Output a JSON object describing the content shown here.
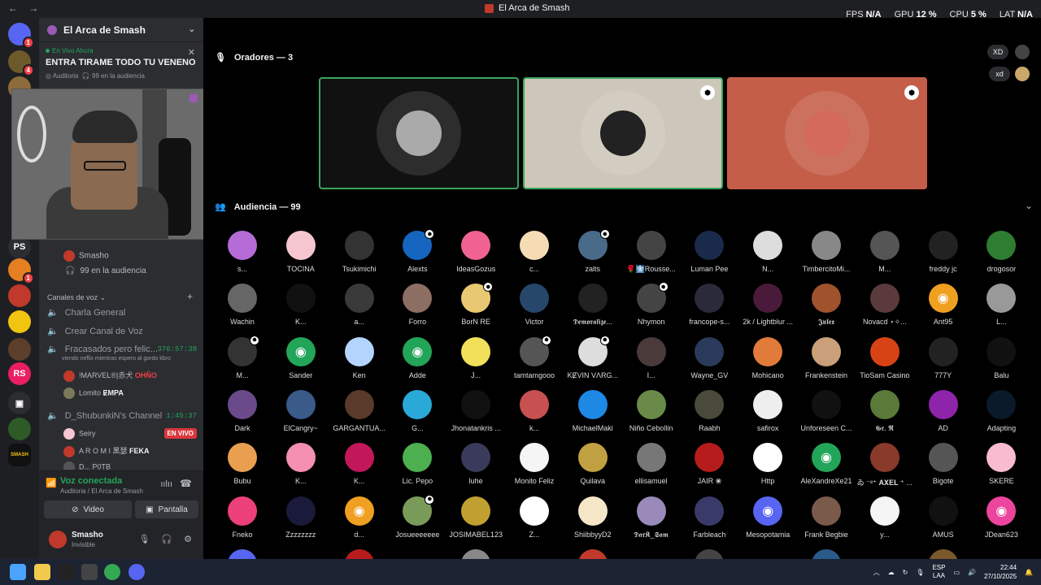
{
  "window": {
    "title": "El Arca de Smash",
    "back": "←",
    "forward": "→"
  },
  "perf": {
    "fps_label": "FPS",
    "fps": "N/A",
    "gpu_label": "GPU",
    "gpu": "12 %",
    "cpu_label": "CPU",
    "cpu": "5 %",
    "lat_label": "LAT",
    "lat": "N/A"
  },
  "servers": [
    {
      "label": "",
      "color": "#5865f2",
      "badge": "1"
    },
    {
      "label": "",
      "color": "#6d5a2a",
      "badge": "4"
    },
    {
      "label": "",
      "color": "#8e6b3b",
      "badge": ""
    },
    {
      "label": "PS",
      "color": "#2b2d31",
      "badge": ""
    },
    {
      "label": "",
      "color": "#e67e22",
      "badge": "1"
    },
    {
      "label": "",
      "color": "#c0392b",
      "badge": ""
    },
    {
      "label": "",
      "color": "#f1c40f",
      "badge": ""
    },
    {
      "label": "",
      "color": "#5b3f2a",
      "badge": ""
    },
    {
      "label": "RS",
      "color": "#e91e63",
      "badge": ""
    },
    {
      "label": "▣",
      "color": "#2b2d31",
      "badge": ""
    },
    {
      "label": "",
      "color": "#2d5a27",
      "badge": ""
    },
    {
      "label": "SMASH",
      "color": "#111111",
      "badge": ""
    }
  ],
  "sidebar": {
    "server_name": "El Arca de Smash",
    "stage": {
      "live_label": "En Vivo Ahora",
      "title": "ENTRA TIRAME TODO TU VENENO",
      "channel": "Auditoria",
      "audience": "99 en la audiencia",
      "close": "✕"
    },
    "stage_host": "Smasho",
    "stage_audience": "99 en la audiencia",
    "voice_category": "Canales de voz",
    "add_channel": "+",
    "channels": [
      {
        "name": "Charla General"
      },
      {
        "name": "Crear Canal de Voz"
      },
      {
        "name": "Fracasados pero felic...",
        "time": "376:57:38",
        "sub": "viendo neflix mientras espero al gordo kbro"
      },
      {
        "name": "D_ShubunkiN's Channel",
        "time": "1:45:37"
      }
    ],
    "members": [
      {
        "name": "!MARVEL®|赤犬",
        "tag": "OHÑO"
      },
      {
        "name": "Lomito",
        "tag": "ɆMPA"
      },
      {
        "name": "Seiry",
        "tag": "EN VIVO"
      },
      {
        "name": "A R O M I 黑瑟",
        "tag": "FEKA"
      },
      {
        "name": "D...",
        "tag": "P0TB"
      }
    ]
  },
  "voice": {
    "status": "Voz conectada",
    "location": "Auditoria / El Arca de Smash",
    "video": "Video",
    "screen": "Pantalla"
  },
  "user": {
    "name": "Smasho",
    "status": "Invisible"
  },
  "main": {
    "speakers_header": "Oradores — 3",
    "audience_header": "Audiencia — 99",
    "reactions": [
      "XD",
      "xd"
    ]
  },
  "speakers": [
    {
      "bg": "#111111",
      "av": "#aaaaaa",
      "border": "#3ba55c",
      "mod": false
    },
    {
      "bg": "#ccc7b8",
      "av": "#222222",
      "border": "#3ba55c",
      "mod": true
    },
    {
      "bg": "#c45e48",
      "av": "#d46a5a",
      "border": "#c45e48",
      "mod": true
    }
  ],
  "audience": [
    {
      "name": "s...",
      "color": "#b56bd6"
    },
    {
      "name": "TOCINA",
      "color": "#f5c6d0"
    },
    {
      "name": "Tsukimichi",
      "color": "#333333"
    },
    {
      "name": "Alexts",
      "color": "#1565c0",
      "mod": true
    },
    {
      "name": "IdeasGozus",
      "color": "#f06292"
    },
    {
      "name": "c...",
      "color": "#f5dcb5"
    },
    {
      "name": "zalts",
      "color": "#4a6a8a",
      "mod": true
    },
    {
      "name": "🌹🩻Rousse...",
      "color": "#444444"
    },
    {
      "name": "Luman Pee",
      "color": "#1a2a4a"
    },
    {
      "name": "N...",
      "color": "#dddddd"
    },
    {
      "name": "TimbercitoMi...",
      "color": "#888888"
    },
    {
      "name": "M...",
      "color": "#555555"
    },
    {
      "name": "freddy jc",
      "color": "#222222"
    },
    {
      "name": "drogosor",
      "color": "#2e7d32"
    },
    {
      "name": "Wachin",
      "color": "#666666"
    },
    {
      "name": "K...",
      "color": "#111111"
    },
    {
      "name": "a...",
      "color": "#3a3a3a"
    },
    {
      "name": "Forro",
      "color": "#8d6e63"
    },
    {
      "name": "BorN RE",
      "color": "#e8c872",
      "mod": true
    },
    {
      "name": "Victor",
      "color": "#26476a"
    },
    {
      "name": "𝕯𝖊𝖒𝖔𝖗𝖆𝖑𝖎𝖟𝖊...",
      "color": "#222222"
    },
    {
      "name": "Nhymon",
      "color": "#444444",
      "mod": true
    },
    {
      "name": "francope-s...",
      "color": "#2a2a3a"
    },
    {
      "name": "2k / Lightblur ...",
      "color": "#4a1a3a"
    },
    {
      "name": "𝕵𝖚𝖑𝖊𝖝",
      "color": "#a0522d"
    },
    {
      "name": "Novacd ⋆✧...",
      "color": "#5a3a3a"
    },
    {
      "name": "Ant95",
      "color": "#f0a020",
      "discord": true
    },
    {
      "name": "L...",
      "color": "#999999"
    },
    {
      "name": "M...",
      "color": "#333333",
      "mod": true
    },
    {
      "name": "Sander",
      "color": "#23a559",
      "discord": true
    },
    {
      "name": "Ken",
      "color": "#b3d4fc"
    },
    {
      "name": "Adde",
      "color": "#23a559",
      "discord": true
    },
    {
      "name": "J...",
      "color": "#f1e05a"
    },
    {
      "name": "tamtamgooo",
      "color": "#555555",
      "mod": true
    },
    {
      "name": "KɆVIN VΛRG...",
      "color": "#dddddd",
      "mod": true
    },
    {
      "name": "I...",
      "color": "#4a3a3a"
    },
    {
      "name": "Wayne_GV",
      "color": "#2a3a5a"
    },
    {
      "name": "Mohicano",
      "color": "#e07b39"
    },
    {
      "name": "Frankenstein",
      "color": "#c9a07a"
    },
    {
      "name": "TioSam Casino",
      "color": "#d84315"
    },
    {
      "name": "777Y",
      "color": "#222222"
    },
    {
      "name": "Balu",
      "color": "#111111"
    },
    {
      "name": "Dark",
      "color": "#6a4a8a"
    },
    {
      "name": "ElCangry~",
      "color": "#3a5a8a"
    },
    {
      "name": "GARGANTUA...",
      "color": "#5a3a2a"
    },
    {
      "name": "G...",
      "color": "#2aa8d8"
    },
    {
      "name": "Jhonatankris ...",
      "color": "#111111"
    },
    {
      "name": "k...",
      "color": "#c75050"
    },
    {
      "name": "MichaelMaki",
      "color": "#1e88e5"
    },
    {
      "name": "Niño Cebollin",
      "color": "#6a8a4a"
    },
    {
      "name": "Raabh",
      "color": "#4a4a3a"
    },
    {
      "name": "safirox",
      "color": "#eeeeee"
    },
    {
      "name": "Unforeseen C...",
      "color": "#111111"
    },
    {
      "name": "𝕲𝖗. 𝕽",
      "color": "#5a7a3a"
    },
    {
      "name": "AD",
      "color": "#8e24aa"
    },
    {
      "name": "Adapting",
      "color": "#0a1a2a"
    },
    {
      "name": "Bubu",
      "color": "#e8a050"
    },
    {
      "name": "K...",
      "color": "#f48fb1"
    },
    {
      "name": "K...",
      "color": "#c2185b"
    },
    {
      "name": "Lic. Pepo",
      "color": "#4caf50"
    },
    {
      "name": "luhe",
      "color": "#3a3a5a"
    },
    {
      "name": "Monito Feliz",
      "color": "#f5f5f5"
    },
    {
      "name": "Quilava",
      "color": "#c0a040"
    },
    {
      "name": "ellisamuel",
      "color": "#777777"
    },
    {
      "name": "JAIR ❀",
      "color": "#b71c1c"
    },
    {
      "name": "Http",
      "color": "#ffffff"
    },
    {
      "name": "AleXandreXe21",
      "color": "#23a559",
      "discord": true
    },
    {
      "name": "ゐ ⁻ᵉ⁺ 𝐀𝐗𝐄𝐋 ⁺ ...",
      "color": "#8a3a2a"
    },
    {
      "name": "Bigote",
      "color": "#555555"
    },
    {
      "name": "SKERE",
      "color": "#f8bbd0"
    },
    {
      "name": "Fneko",
      "color": "#ec407a"
    },
    {
      "name": "Zzzzzzzz",
      "color": "#1a1a3a"
    },
    {
      "name": "d...",
      "color": "#f0a020",
      "discord": true
    },
    {
      "name": "Josueeeeeee",
      "color": "#7a9a5a",
      "mod": true
    },
    {
      "name": "JOSIMABEL123",
      "color": "#c0a030"
    },
    {
      "name": "Z...",
      "color": "#ffffff"
    },
    {
      "name": "ShiibbyyD2",
      "color": "#f5e6c8"
    },
    {
      "name": "𝕯𝖆𝖗𝕶_𝕾𝖆𝖒",
      "color": "#9a8aba"
    },
    {
      "name": "Farbleach",
      "color": "#3a3a6a"
    },
    {
      "name": "Mesopotamia",
      "color": "#5865f2",
      "discord": true
    },
    {
      "name": "Frank Begbie",
      "color": "#7a5a4a"
    },
    {
      "name": "y...",
      "color": "#f5f5f5"
    },
    {
      "name": "AMUS",
      "color": "#111111"
    },
    {
      "name": "JDean623",
      "color": "#eb459e",
      "discord": true
    }
  ],
  "taskbar": {
    "lang1": "ESP",
    "lang2": "LAA",
    "time": "22:44",
    "date": "27/10/2025"
  }
}
